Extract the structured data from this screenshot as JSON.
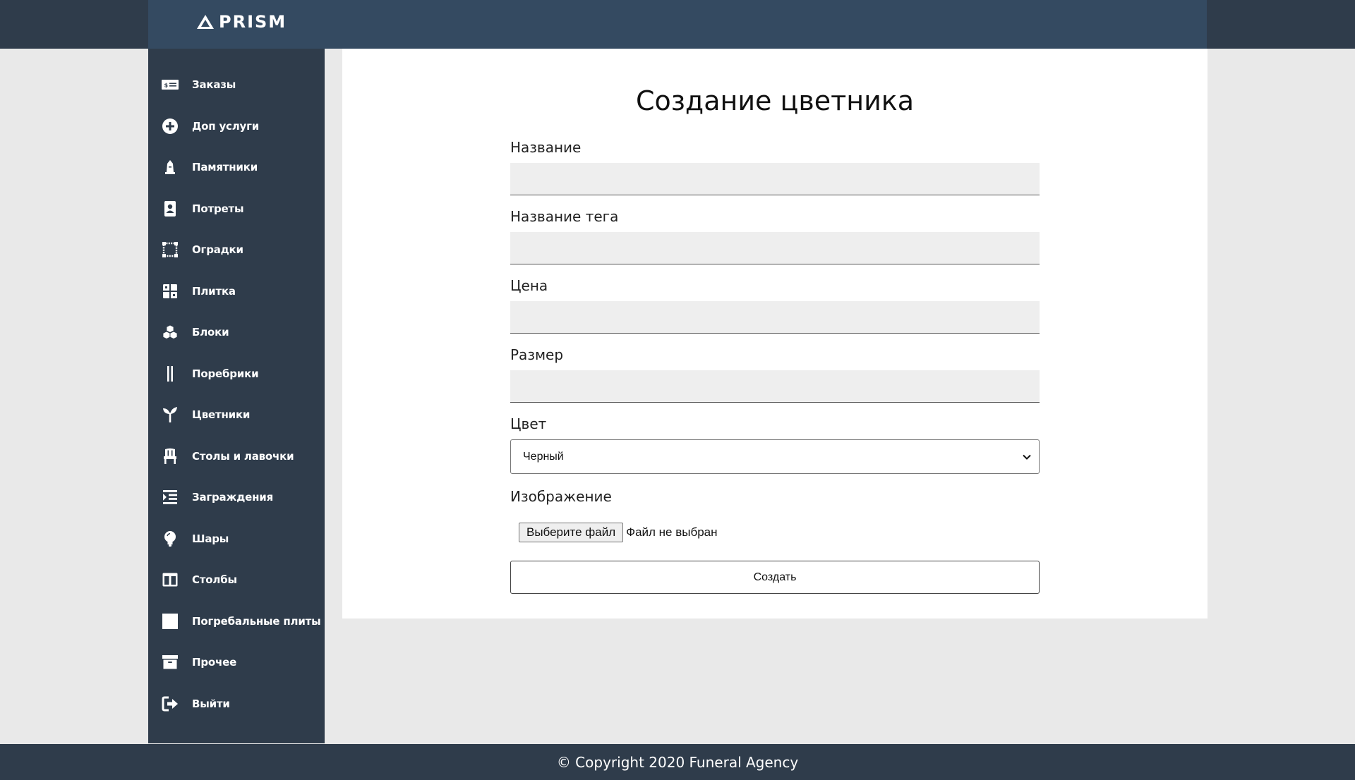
{
  "header": {
    "logo_text": "PRISM"
  },
  "sidebar": {
    "items": [
      {
        "label": "Заказы",
        "icon": "money-bill-icon"
      },
      {
        "label": "Доп услуги",
        "icon": "plus-circle-icon"
      },
      {
        "label": "Памятники",
        "icon": "monument-icon"
      },
      {
        "label": "Потреты",
        "icon": "portrait-icon"
      },
      {
        "label": "Оградки",
        "icon": "vector-square-icon"
      },
      {
        "label": "Плитка",
        "icon": "th-large-icon"
      },
      {
        "label": "Блоки",
        "icon": "cubes-icon"
      },
      {
        "label": "Поребрики",
        "icon": "grip-lines-vertical-icon"
      },
      {
        "label": "Цветники",
        "icon": "seedling-icon"
      },
      {
        "label": "Столы и лавочки",
        "icon": "chair-icon"
      },
      {
        "label": "Заграждения",
        "icon": "list-indent-icon"
      },
      {
        "label": "Шары",
        "icon": "lightbulb-icon"
      },
      {
        "label": "Столбы",
        "icon": "columns-icon"
      },
      {
        "label": "Погребальные плиты",
        "icon": "square-icon"
      },
      {
        "label": "Прочее",
        "icon": "archive-icon"
      },
      {
        "label": "Выйти",
        "icon": "sign-out-icon"
      }
    ]
  },
  "main": {
    "title": "Создание цветника",
    "fields": {
      "name_label": "Название",
      "name_value": "",
      "tag_label": "Название тега",
      "tag_value": "",
      "price_label": "Цена",
      "price_value": "",
      "size_label": "Размер",
      "size_value": "",
      "color_label": "Цвет",
      "color_selected": "Черный",
      "image_label": "Изображение",
      "file_button": "Выберите файл",
      "file_status": "Файл не выбран"
    },
    "submit_label": "Создать"
  },
  "footer": {
    "text": "© Copyright 2020 Funeral Agency"
  },
  "colors": {
    "header_bg": "#2f3c4b",
    "header_inner_bg": "#344a61",
    "sidebar_bg": "#2f3c4b",
    "page_bg": "#e9e9e9",
    "input_bg": "#eeeeee"
  }
}
